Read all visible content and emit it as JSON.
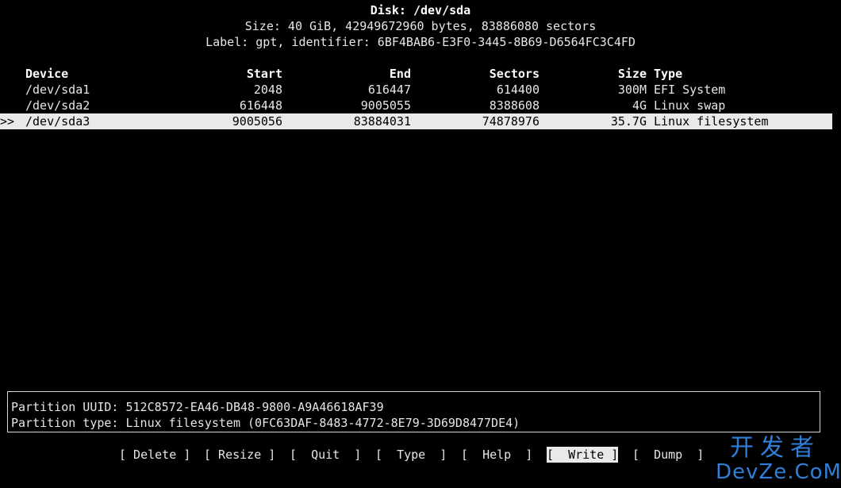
{
  "header": {
    "disk_title": "Disk: /dev/sda",
    "size_line": "Size: 40 GiB, 42949672960 bytes, 83886080 sectors",
    "label_line": "Label: gpt, identifier: 6BF4BAB6-E3F0-3445-8B69-D6564FC3C4FD"
  },
  "table": {
    "columns": {
      "device": "Device",
      "start": "Start",
      "end": "End",
      "sectors": "Sectors",
      "size": "Size",
      "type": "Type"
    },
    "rows": [
      {
        "device": "/dev/sda1",
        "start": "2048",
        "end": "616447",
        "sectors": "614400",
        "size": "300M",
        "type": "EFI System"
      },
      {
        "device": "/dev/sda2",
        "start": "616448",
        "end": "9005055",
        "sectors": "8388608",
        "size": "4G",
        "type": "Linux swap"
      },
      {
        "device": "/dev/sda3",
        "start": "9005056",
        "end": "83884031",
        "sectors": "74878976",
        "size": "35.7G",
        "type": "Linux filesystem"
      }
    ],
    "selected_marker": ">>"
  },
  "info": {
    "uuid_line": "Partition UUID: 512C8572-EA46-DB48-9800-A9A46618AF39",
    "type_line": "Partition type: Linux filesystem (0FC63DAF-8483-4772-8E79-3D69D8477DE4)"
  },
  "menu": {
    "delete": "[ Delete ]",
    "resize": "[ Resize ]",
    "quit": "[  Quit  ]",
    "type": "[  Type  ]",
    "help": "[  Help  ]",
    "write": "[  Write ]",
    "dump": "[  Dump  ]"
  },
  "watermark": {
    "top": "开发者",
    "bottom": "DevZe.CoM"
  },
  "colors": {
    "background": "#000000",
    "foreground": "#e6e6e6",
    "selection": "#e9e9e9",
    "watermark": "#2f7ed8"
  }
}
